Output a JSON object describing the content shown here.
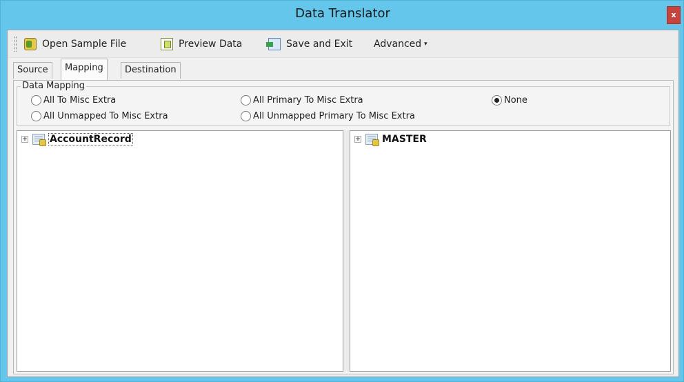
{
  "window": {
    "title": "Data Translator",
    "close_label": "x"
  },
  "toolbar": {
    "open_sample_label": "Open Sample File",
    "preview_label": "Preview Data",
    "save_exit_label": "Save and Exit",
    "advanced_label": "Advanced",
    "icons": [
      "open-sample-file-icon",
      "preview-data-icon",
      "save-and-exit-icon",
      "dropdown-caret-icon"
    ]
  },
  "tabs": [
    {
      "label": "Source",
      "active": false
    },
    {
      "label": "Mapping",
      "active": true
    },
    {
      "label": "Destination",
      "active": false
    }
  ],
  "mapping": {
    "group_title": "Data Mapping",
    "options": [
      {
        "label": "All To Misc Extra",
        "checked": false
      },
      {
        "label": "All Primary To Misc Extra",
        "checked": false
      },
      {
        "label": "None",
        "checked": true
      },
      {
        "label": "All Unmapped To Misc Extra",
        "checked": false
      },
      {
        "label": "All Unmapped Primary To Misc Extra",
        "checked": false
      }
    ]
  },
  "source_tree": {
    "root_label": "AccountRecord",
    "expander": "+"
  },
  "destination_tree": {
    "root_label": "MASTER",
    "expander": "+"
  },
  "colors": {
    "titlebar": "#63c6ea",
    "close_button": "#c5443e",
    "client_bg": "#f0f0f0"
  }
}
